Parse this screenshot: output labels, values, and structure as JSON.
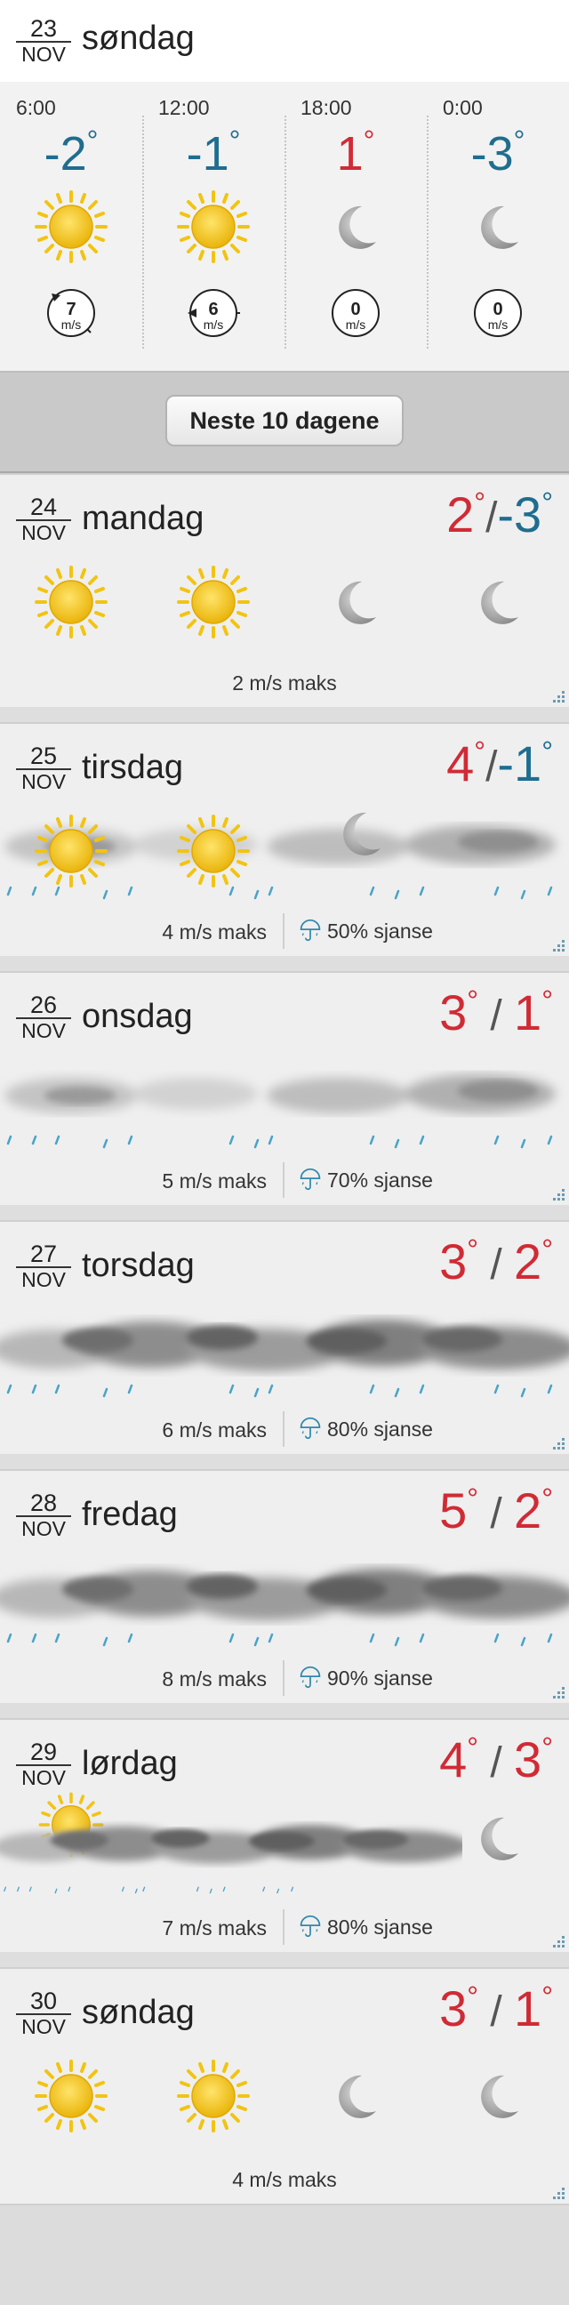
{
  "today": {
    "date_num": "23",
    "month": "NOV",
    "day_name": "søndag",
    "periods": [
      {
        "time": "6:00",
        "temp": "-2",
        "icon": "sun-icon",
        "wind": "7",
        "wind_unit": "m/s"
      },
      {
        "time": "12:00",
        "temp": "-1",
        "icon": "sun-icon",
        "wind": "6",
        "wind_unit": "m/s"
      },
      {
        "time": "18:00",
        "temp": "1",
        "icon": "moon-icon",
        "wind": "0",
        "wind_unit": "m/s"
      },
      {
        "time": "0:00",
        "temp": "-3",
        "icon": "moon-icon",
        "wind": "0",
        "wind_unit": "m/s"
      }
    ]
  },
  "next_button": "Neste 10 dagene",
  "days": [
    {
      "date_num": "24",
      "month": "NOV",
      "name": "mandag",
      "hi": "2",
      "lo": "-3",
      "wind": "2 m/s maks",
      "chance": ""
    },
    {
      "date_num": "25",
      "month": "NOV",
      "name": "tirsdag",
      "hi": "4",
      "lo": "-1",
      "wind": "4 m/s maks",
      "chance": "50% sjanse"
    },
    {
      "date_num": "26",
      "month": "NOV",
      "name": "onsdag",
      "hi": "3",
      "lo": "1",
      "wind": "5 m/s maks",
      "chance": "70% sjanse"
    },
    {
      "date_num": "27",
      "month": "NOV",
      "name": "torsdag",
      "hi": "3",
      "lo": "2",
      "wind": "6 m/s maks",
      "chance": "80% sjanse"
    },
    {
      "date_num": "28",
      "month": "NOV",
      "name": "fredag",
      "hi": "5",
      "lo": "2",
      "wind": "8 m/s maks",
      "chance": "90% sjanse"
    },
    {
      "date_num": "29",
      "month": "NOV",
      "name": "lørdag",
      "hi": "4",
      "lo": "3",
      "wind": "7 m/s maks",
      "chance": "80% sjanse"
    },
    {
      "date_num": "30",
      "month": "NOV",
      "name": "søndag",
      "hi": "3",
      "lo": "1",
      "wind": "4 m/s maks",
      "chance": ""
    }
  ],
  "colors": {
    "warm": "#d02b35",
    "cold": "#1f6d8f",
    "sun": "#f2c412",
    "rain": "#4aa3c8"
  }
}
